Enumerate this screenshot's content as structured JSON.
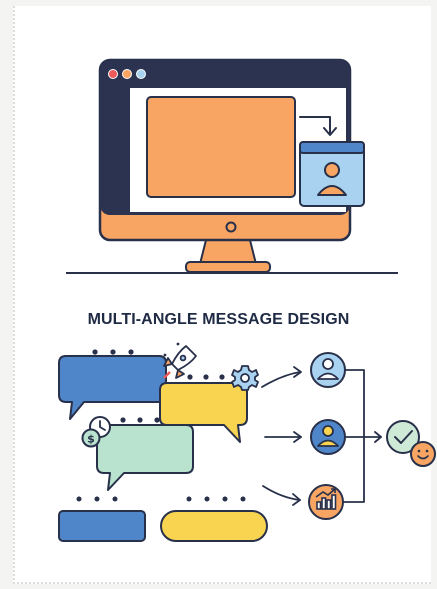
{
  "page": {
    "title": "MULTI-ANGLE MESSAGE DESIGN"
  },
  "icons": {
    "monitor": "desktop-monitor-icon",
    "window_dots": "window-controls-icon",
    "arrow": "curved-arrow-icon",
    "profile_card": "user-profile-card-icon",
    "rocket": "rocket-icon",
    "gear": "gear-icon",
    "clock": "clock-icon",
    "dollar": "dollar-coin-icon",
    "audience_a": "user-avatar-icon",
    "audience_b": "user-avatar-icon",
    "audience_c": "bar-chart-icon",
    "check": "check-icon",
    "smile": "smiley-face-icon"
  },
  "colors": {
    "navy": "#28304a",
    "orange": "#f8a564",
    "yellow": "#f8d451",
    "blue": "#4e86c9",
    "light_blue": "#a8d2f0",
    "mint": "#b9e3ce",
    "green_check": "#cfe9d7",
    "red_dot": "#ef5a5a"
  }
}
